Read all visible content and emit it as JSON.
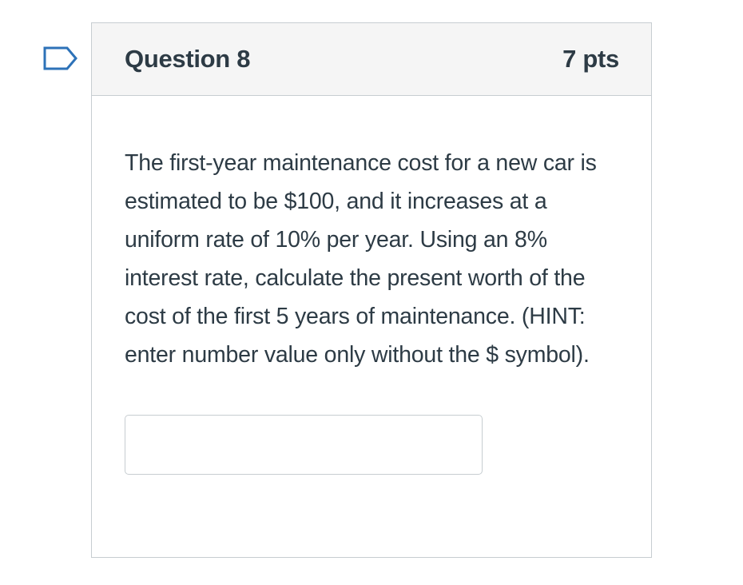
{
  "question": {
    "title": "Question 8",
    "points": "7 pts",
    "text": "The first-year maintenance cost for a new car is estimated to be $100, and it increases at a uniform rate of 10% per year.  Using an 8% interest rate, calculate the present worth of the cost of the first 5 years of maintenance.  (HINT: enter number value only without the $ symbol).",
    "answer": {
      "value": "",
      "placeholder": ""
    }
  },
  "icons": {
    "flag": "flag-question-icon"
  },
  "colors": {
    "text": "#2d3b45",
    "border": "#c7cdd1",
    "header_bg": "#f5f5f5",
    "flag_outline": "#2d72b8"
  }
}
